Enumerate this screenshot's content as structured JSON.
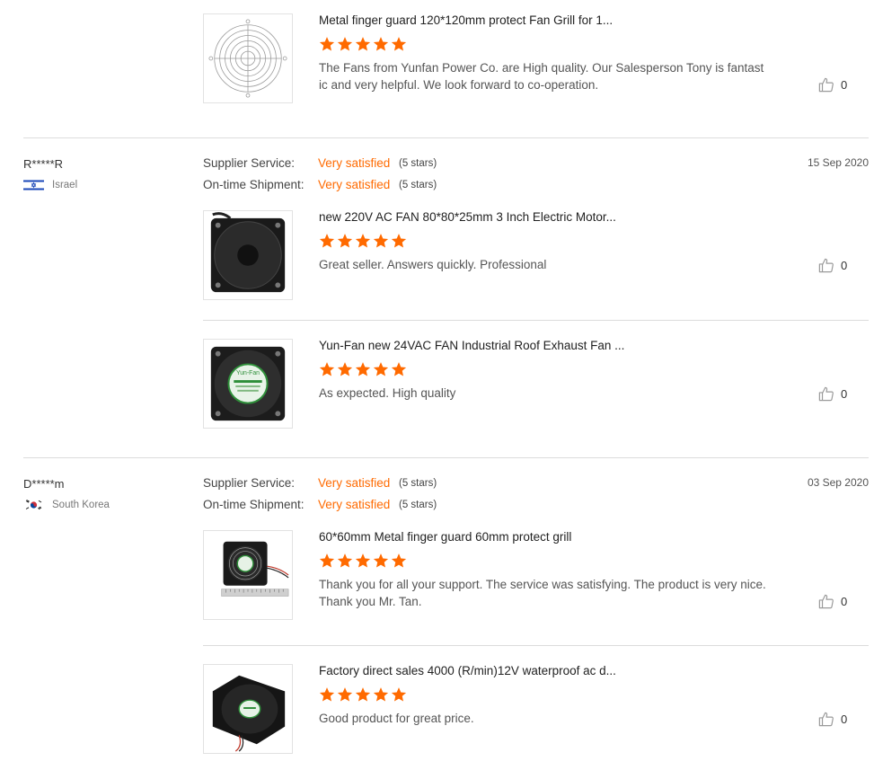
{
  "colors": {
    "accent": "#ff6a00",
    "star": "#ff6a00",
    "divider": "#dcdcdc"
  },
  "reviews": [
    {
      "products": [
        {
          "title": "Metal finger guard 120*120mm protect Fan Grill for 1...",
          "rating": 5,
          "text": "The Fans from Yunfan Power Co. are High quality. Our Salesperson Tony is fantastic and very helpful. We look forward to co-operation.",
          "likes": "0",
          "image_icon": "fan-grill-icon"
        }
      ]
    },
    {
      "user": "R*****R",
      "country": "Israel",
      "flag_icon": "israel-flag-icon",
      "date": "15 Sep 2020",
      "supplier_service_label": "Supplier Service:",
      "supplier_service_value": "Very satisfied",
      "supplier_service_stars": "(5 stars)",
      "shipment_label": "On-time Shipment:",
      "shipment_value": "Very satisfied",
      "shipment_stars": "(5 stars)",
      "products": [
        {
          "title": "new 220V AC FAN 80*80*25mm 3 Inch Electric Motor...",
          "rating": 5,
          "text": "Great seller. Answers quickly. Professional",
          "likes": "0",
          "image_icon": "ac-fan-icon"
        },
        {
          "title": "Yun-Fan new 24VAC FAN Industrial Roof Exhaust Fan ...",
          "rating": 5,
          "text": "As expected. High quality",
          "likes": "0",
          "image_icon": "ac-fan-labeled-icon",
          "image_text": "Yun-Fan"
        }
      ]
    },
    {
      "user": "D*****m",
      "country": "South Korea",
      "flag_icon": "south-korea-flag-icon",
      "date": "03 Sep 2020",
      "supplier_service_label": "Supplier Service:",
      "supplier_service_value": "Very satisfied",
      "supplier_service_stars": "(5 stars)",
      "shipment_label": "On-time Shipment:",
      "shipment_value": "Very satisfied",
      "shipment_stars": "(5 stars)",
      "products": [
        {
          "title": "60*60mm Metal finger guard 60mm protect grill",
          "rating": 5,
          "text": "Thank you for all your support. The service was satisfying. The product is very nice. Thank you Mr. Tan.",
          "likes": "0",
          "image_icon": "small-fan-with-guard-icon"
        },
        {
          "title": "Factory direct sales 4000 (R/min)12V waterproof ac d...",
          "rating": 5,
          "text": "Good product for great price.",
          "likes": "0",
          "image_icon": "dc-fan-icon"
        }
      ]
    }
  ]
}
